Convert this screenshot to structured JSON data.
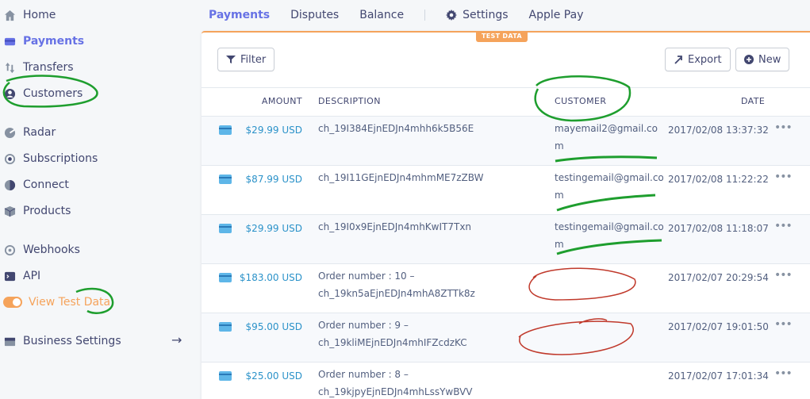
{
  "sidebar": {
    "items": [
      {
        "label": "Home",
        "icon": "home-icon"
      },
      {
        "label": "Payments",
        "icon": "payments-icon"
      },
      {
        "label": "Transfers",
        "icon": "transfers-icon"
      },
      {
        "label": "Customers",
        "icon": "customers-icon"
      },
      {
        "label": "Radar",
        "icon": "radar-icon"
      },
      {
        "label": "Subscriptions",
        "icon": "subscriptions-icon"
      },
      {
        "label": "Connect",
        "icon": "connect-icon"
      },
      {
        "label": "Products",
        "icon": "products-icon"
      },
      {
        "label": "Webhooks",
        "icon": "webhooks-icon"
      },
      {
        "label": "API",
        "icon": "api-icon"
      },
      {
        "label": "View Test Data",
        "icon": "toggle"
      },
      {
        "label": "Business Settings",
        "icon": "business-settings-icon"
      }
    ]
  },
  "topnav": {
    "tabs": [
      "Payments",
      "Disputes",
      "Balance"
    ],
    "settings": "Settings",
    "apple_pay": "Apple Pay"
  },
  "panel": {
    "badge": "TEST DATA",
    "filter": "Filter",
    "export": "Export",
    "new": "New"
  },
  "table": {
    "headers": {
      "amount": "AMOUNT",
      "description": "DESCRIPTION",
      "customer": "CUSTOMER",
      "date": "DATE"
    },
    "rows": [
      {
        "amount": "$29.99 USD",
        "description": "ch_19I384EjnEDJn4mhh6k5B56E",
        "customer": "mayemail2@gmail.com",
        "date": "2017/02/08 13:37:32"
      },
      {
        "amount": "$87.99 USD",
        "description": "ch_19I11GEjnEDJn4mhmME7zZBW",
        "customer": "testingemail@gmail.com",
        "date": "2017/02/08 11:22:22"
      },
      {
        "amount": "$29.99 USD",
        "description": "ch_19I0x9EjnEDJn4mhKwIT7Txn",
        "customer": "testingemail@gmail.com",
        "date": "2017/02/08 11:18:07"
      },
      {
        "amount": "$183.00 USD",
        "description": "Order number : 10 – ch_19kn5aEjnEDJn4mhA8ZTTk8z",
        "customer": "",
        "date": "2017/02/07 20:29:54"
      },
      {
        "amount": "$95.00 USD",
        "description": "Order number : 9 – ch_19kliMEjnEDJn4mhIFZcdzKC",
        "customer": "",
        "date": "2017/02/07 19:01:50"
      },
      {
        "amount": "$25.00 USD",
        "description": "Order number : 8 – ch_19kjpyEjnEDJn4mhLssYwBVV",
        "customer": "",
        "date": "2017/02/07 17:01:34"
      }
    ],
    "more_glyph": "•••"
  },
  "colors": {
    "accent": "#6772e5",
    "test": "#f5a35b",
    "amount": "#2b92c9"
  }
}
